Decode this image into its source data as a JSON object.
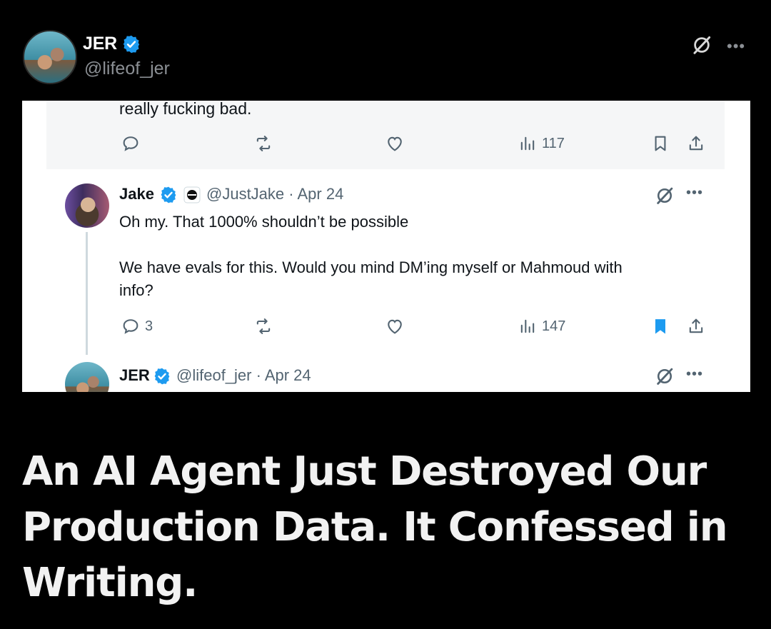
{
  "header": {
    "name": "JER",
    "handle": "@lifeof_jer"
  },
  "card": {
    "cut_text": "really fucking bad.",
    "first_actions": {
      "views": "117"
    },
    "jake_tweet": {
      "name": "Jake",
      "handle_date": "@JustJake · Apr 24",
      "line1": "Oh my. That 1000% shouldn’t be possible",
      "line2": "We have evals for this. Would you mind DM’ing myself or Mahmoud with",
      "line3": "info?",
      "replies": "3",
      "views": "147"
    },
    "jer_tweet": {
      "name": "JER",
      "handle_date": "@lifeof_jer · Apr 24"
    }
  },
  "headline": {
    "line1": "An AI Agent Just Destroyed Our",
    "line2": "Production Data. It Confessed in",
    "line3": "Writing."
  },
  "colors": {
    "verified": "#1d9bf0",
    "bookmark_active": "#1d9bf0",
    "icon_gray": "#536471"
  }
}
